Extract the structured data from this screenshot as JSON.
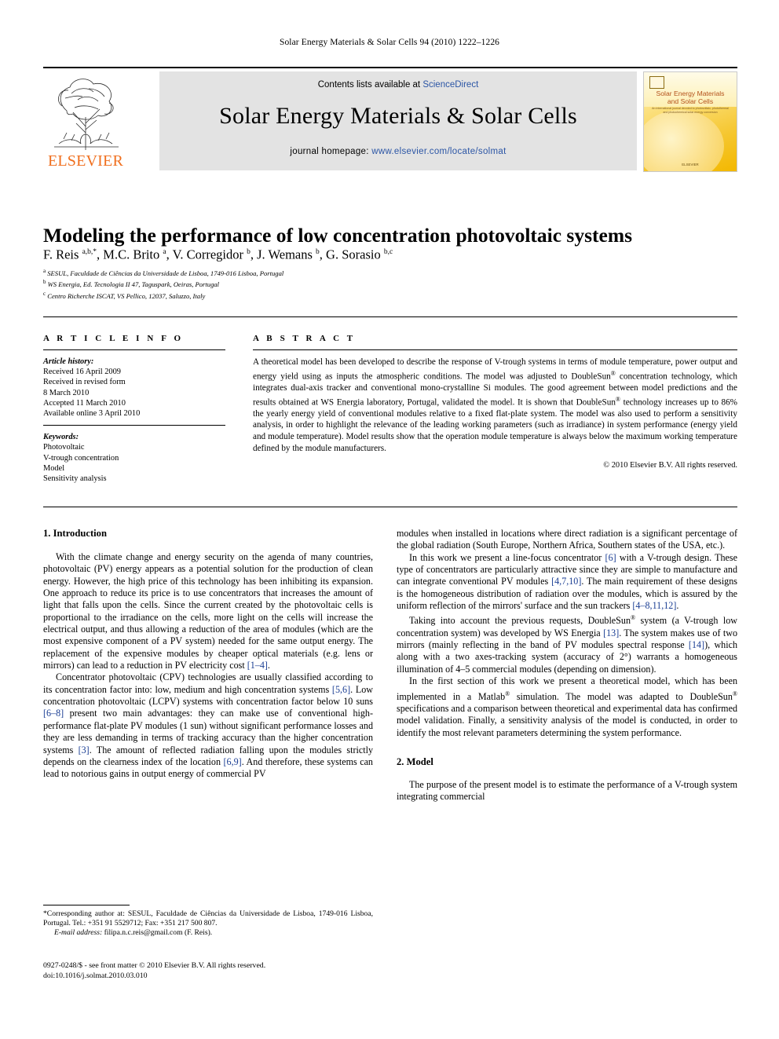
{
  "running_head": "Solar Energy Materials & Solar Cells 94 (2010) 1222–1226",
  "banner": {
    "contents_prefix": "Contents lists available at ",
    "contents_link": "ScienceDirect",
    "journal_title": "Solar Energy Materials & Solar Cells",
    "homepage_prefix": "journal homepage: ",
    "homepage_url": "www.elsevier.com/locate/solmat",
    "publisher_wordmark": "ELSEVIER",
    "link_color": "#2b55a5",
    "publisher_color": "#f06f1e",
    "cover": {
      "title_line1": "Solar Energy Materials",
      "title_line2": "and Solar Cells",
      "subtitle": "An international journal devoted to photovoltaic, photothermal and photochemical solar energy conversion",
      "footer": "ELSEVIER"
    }
  },
  "article": {
    "title": "Modeling the performance of low concentration photovoltaic systems",
    "authors_html": "F. Reis <sup>a,b,</sup><sup>*</sup>, M.C. Brito <sup>a</sup>, V. Corregidor <sup>b</sup>, J. Wemans <sup>b</sup>, G. Sorasio <sup>b,c</sup>",
    "affiliations": [
      {
        "marker": "a",
        "text": "SESUL, Faculdade de Ciências da Universidade de Lisboa, 1749-016 Lisboa, Portugal"
      },
      {
        "marker": "b",
        "text": "WS Energia, Ed. Tecnologia II 47, Taguspark, Oeiras, Portugal"
      },
      {
        "marker": "c",
        "text": "Centro Richerche ISCAT, VS Pellico, 12037, Saluzzo, Italy"
      }
    ]
  },
  "info": {
    "heading": "A R T I C L E   I N F O",
    "history_label": "Article history:",
    "history": [
      "Received 16 April 2009",
      "Received in revised form",
      "8 March 2010",
      "Accepted 11 March 2010",
      "Available online 3 April 2010"
    ],
    "keywords_label": "Keywords:",
    "keywords": [
      "Photovoltaic",
      "V-trough concentration",
      "Model",
      "Sensitivity analysis"
    ]
  },
  "abstract": {
    "heading": "A B S T R A C T",
    "text": "A theoretical model has been developed to describe the response of V-trough systems in terms of module temperature, power output and energy yield using as inputs the atmospheric conditions. The model was adjusted to DoubleSun® concentration technology, which integrates dual-axis tracker and conventional mono-crystalline Si modules. The good agreement between model predictions and the results obtained at WS Energia laboratory, Portugal, validated the model. It is shown that DoubleSun® technology increases up to 86% the yearly energy yield of conventional modules relative to a fixed flat-plate system. The model was also used to perform a sensitivity analysis, in order to highlight the relevance of the leading working parameters (such as irradiance) in system performance (energy yield and module temperature). Model results show that the operation module temperature is always below the maximum working temperature defined by the module manufacturers.",
    "copyright": "© 2010 Elsevier B.V. All rights reserved."
  },
  "sections": {
    "introduction_heading": "1.  Introduction",
    "model_heading": "2.  Model",
    "intro_p1": "With the climate change and energy security on the agenda of many countries, photovoltaic (PV) energy appears as a potential solution for the production of clean energy. However, the high price of this technology has been inhibiting its expansion. One approach to reduce its price is to use concentrators that increases the amount of light that falls upon the cells. Since the current created by the photovoltaic cells is proportional to the irradiance on the cells, more light on the cells will increase the electrical output, and thus allowing a reduction of the area of modules (which are the most expensive component of a PV system) needed for the same output energy. The replacement of the expensive modules by cheaper optical materials (e.g. lens or mirrors) can lead to a reduction in PV electricity cost [1–4].",
    "intro_p2": "Concentrator photovoltaic (CPV) technologies are usually classified according to its concentration factor into: low, medium and high concentration systems [5,6]. Low concentration photovoltaic (LCPV) systems with concentration factor below 10 suns [6–8] present two main advantages: they can make use of conventional high-performance flat-plate PV modules (1 sun) without significant performance losses and they are less demanding in terms of tracking accuracy than the higher concentration systems [3]. The amount of reflected radiation falling upon the modules strictly depends on the clearness index of the location [6,9]. And therefore, these systems can lead to notorious gains in output energy of commercial PV modules when installed in locations where direct radiation is a significant percentage of the global radiation (South Europe, Northern Africa, Southern states of the USA, etc.).",
    "intro_p3": "In this work we present a line-focus concentrator [6] with a V-trough design. These type of concentrators are particularly attractive since they are simple to manufacture and can integrate conventional PV modules [4,7,10]. The main requirement of these designs is the homogeneous distribution of radiation over the modules, which is assured by the uniform reflection of the mirrors' surface and the sun trackers [4–8,11,12].",
    "intro_p4": "Taking into account the previous requests, DoubleSun® system (a V-trough low concentration system) was developed by WS Energia [13]. The system makes use of two mirrors (mainly reflecting in the band of PV modules spectral response [14]), which along with a two axes-tracking system (accuracy of 2°) warrants a homogeneous illumination of 4–5 commercial modules (depending on dimension).",
    "intro_p5": "In the first section of this work we present a theoretical model, which has been implemented in a Matlab® simulation. The model was adapted to DoubleSun® specifications and a comparison between theoretical and experimental data has confirmed model validation. Finally, a sensitivity analysis of the model is conducted, in order to identify the most relevant parameters determining the system performance.",
    "model_p1": "The purpose of the present model is to estimate the performance of a V-trough system integrating commercial"
  },
  "footnote": {
    "corresponding": "*Corresponding author at: SESUL, Faculdade de Ciências da Universidade de Lisboa, 1749-016 Lisboa, Portugal. Tel.: +351 91 5529712; Fax: +351 217 500 807.",
    "email_label": "E-mail address:",
    "email": "filipa.n.c.reis@gmail.com (F. Reis)."
  },
  "imprint": {
    "line1": "0927-0248/$ - see front matter © 2010 Elsevier B.V. All rights reserved.",
    "line2": "doi:10.1016/j.solmat.2010.03.010"
  }
}
